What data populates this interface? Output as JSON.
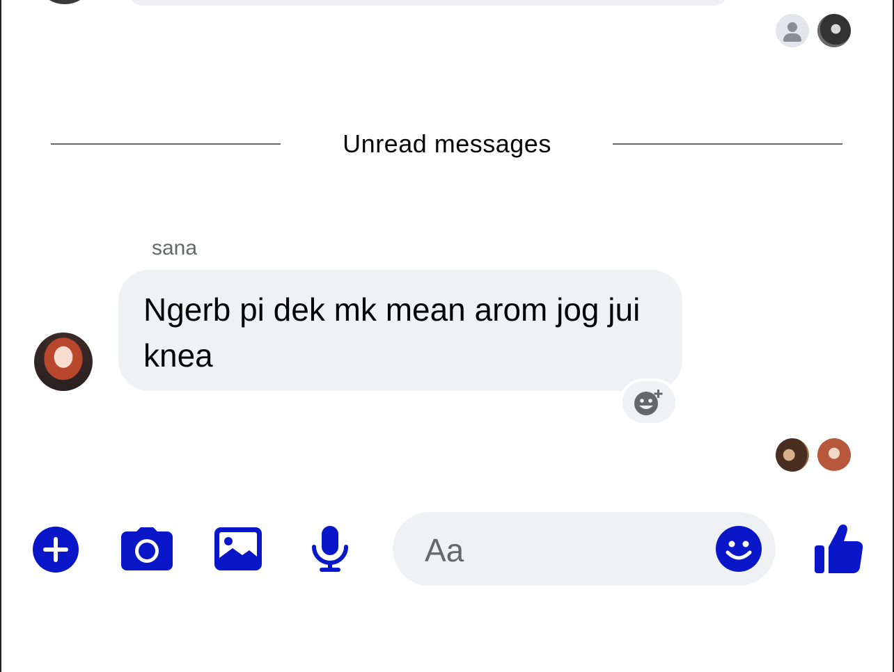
{
  "divider": {
    "label": "Unread messages"
  },
  "message": {
    "sender": "sana",
    "text": "Ngerb pi dek mk mean arom jog jui knea"
  },
  "composer": {
    "placeholder": "Aa"
  },
  "colors": {
    "accent": "#0a17c9",
    "bubble": "#f0f1f5",
    "secondary_text": "#65676b"
  },
  "icons": {
    "add": "plus-circle-icon",
    "camera": "camera-icon",
    "gallery": "image-icon",
    "voice": "microphone-icon",
    "emoji": "smiley-icon",
    "like": "thumbs-up-icon",
    "react": "add-reaction-icon"
  }
}
